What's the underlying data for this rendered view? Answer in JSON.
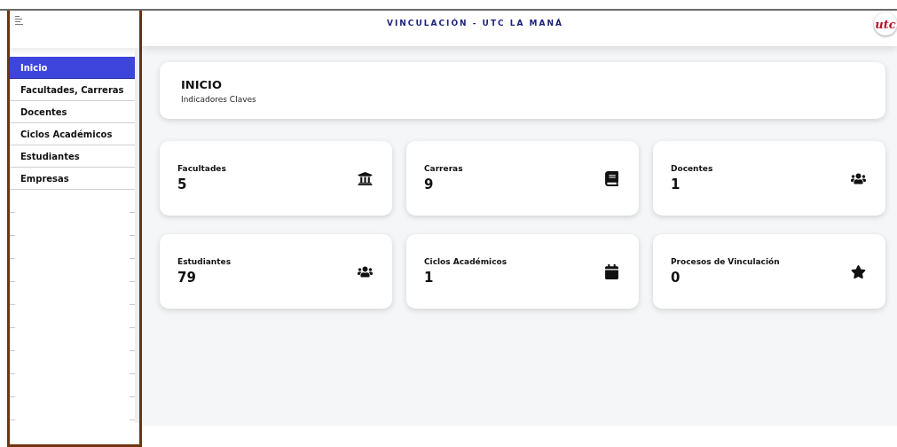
{
  "header": {
    "title": "VINCULACIÓN - UTC LA MANÁ",
    "logo": "utc"
  },
  "sidebar": {
    "items": [
      {
        "label": "Inicio",
        "selected": true
      },
      {
        "label": "Facultades, Carreras",
        "selected": false
      },
      {
        "label": "Docentes",
        "selected": false
      },
      {
        "label": "Ciclos Académicos",
        "selected": false
      },
      {
        "label": "Estudiantes",
        "selected": false
      },
      {
        "label": "Empresas",
        "selected": false
      }
    ]
  },
  "intro": {
    "title": "INICIO",
    "subtitle": "Indicadores Claves"
  },
  "stats": [
    {
      "label": "Facultades",
      "value": "5"
    },
    {
      "label": "Carreras",
      "value": "9"
    },
    {
      "label": "Docentes",
      "value": "1"
    },
    {
      "label": "Estudiantes",
      "value": "79"
    },
    {
      "label": "Ciclos Académicos",
      "value": "1"
    },
    {
      "label": "Procesos de Vinculación",
      "value": "0"
    }
  ]
}
